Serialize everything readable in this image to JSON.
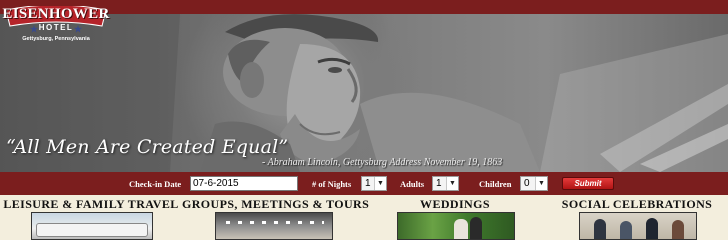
{
  "brand": {
    "name": "EISENHOWER",
    "subname": "HOTEL",
    "location": "Gettysburg, Pennsylvania"
  },
  "hero": {
    "quote": "“All Men Are Created Equal”",
    "attribution": "- Abraham Lincoln, Gettysburg Address November 19, 1863"
  },
  "booking": {
    "checkin_label": "Check-in Date",
    "checkin_value": "07-6-2015",
    "nights_label": "# of Nights",
    "nights_value": "1",
    "adults_label": "Adults",
    "adults_value": "1",
    "children_label": "Children",
    "children_value": "0",
    "submit_label": "Submit"
  },
  "categories": [
    {
      "title": "LEISURE & FAMILY TRAVEL"
    },
    {
      "title": "GROUPS, MEETINGS & TOURS"
    },
    {
      "title": "WEDDINGS"
    },
    {
      "title": "SOCIAL CELEBRATIONS"
    }
  ],
  "colors": {
    "brand_red": "#7b1e1e",
    "submit_red": "#c62020",
    "page_background": "#f3eedd"
  },
  "icons": {
    "dropdown": "chevron-down-icon",
    "logo_stars": "star-icon"
  }
}
